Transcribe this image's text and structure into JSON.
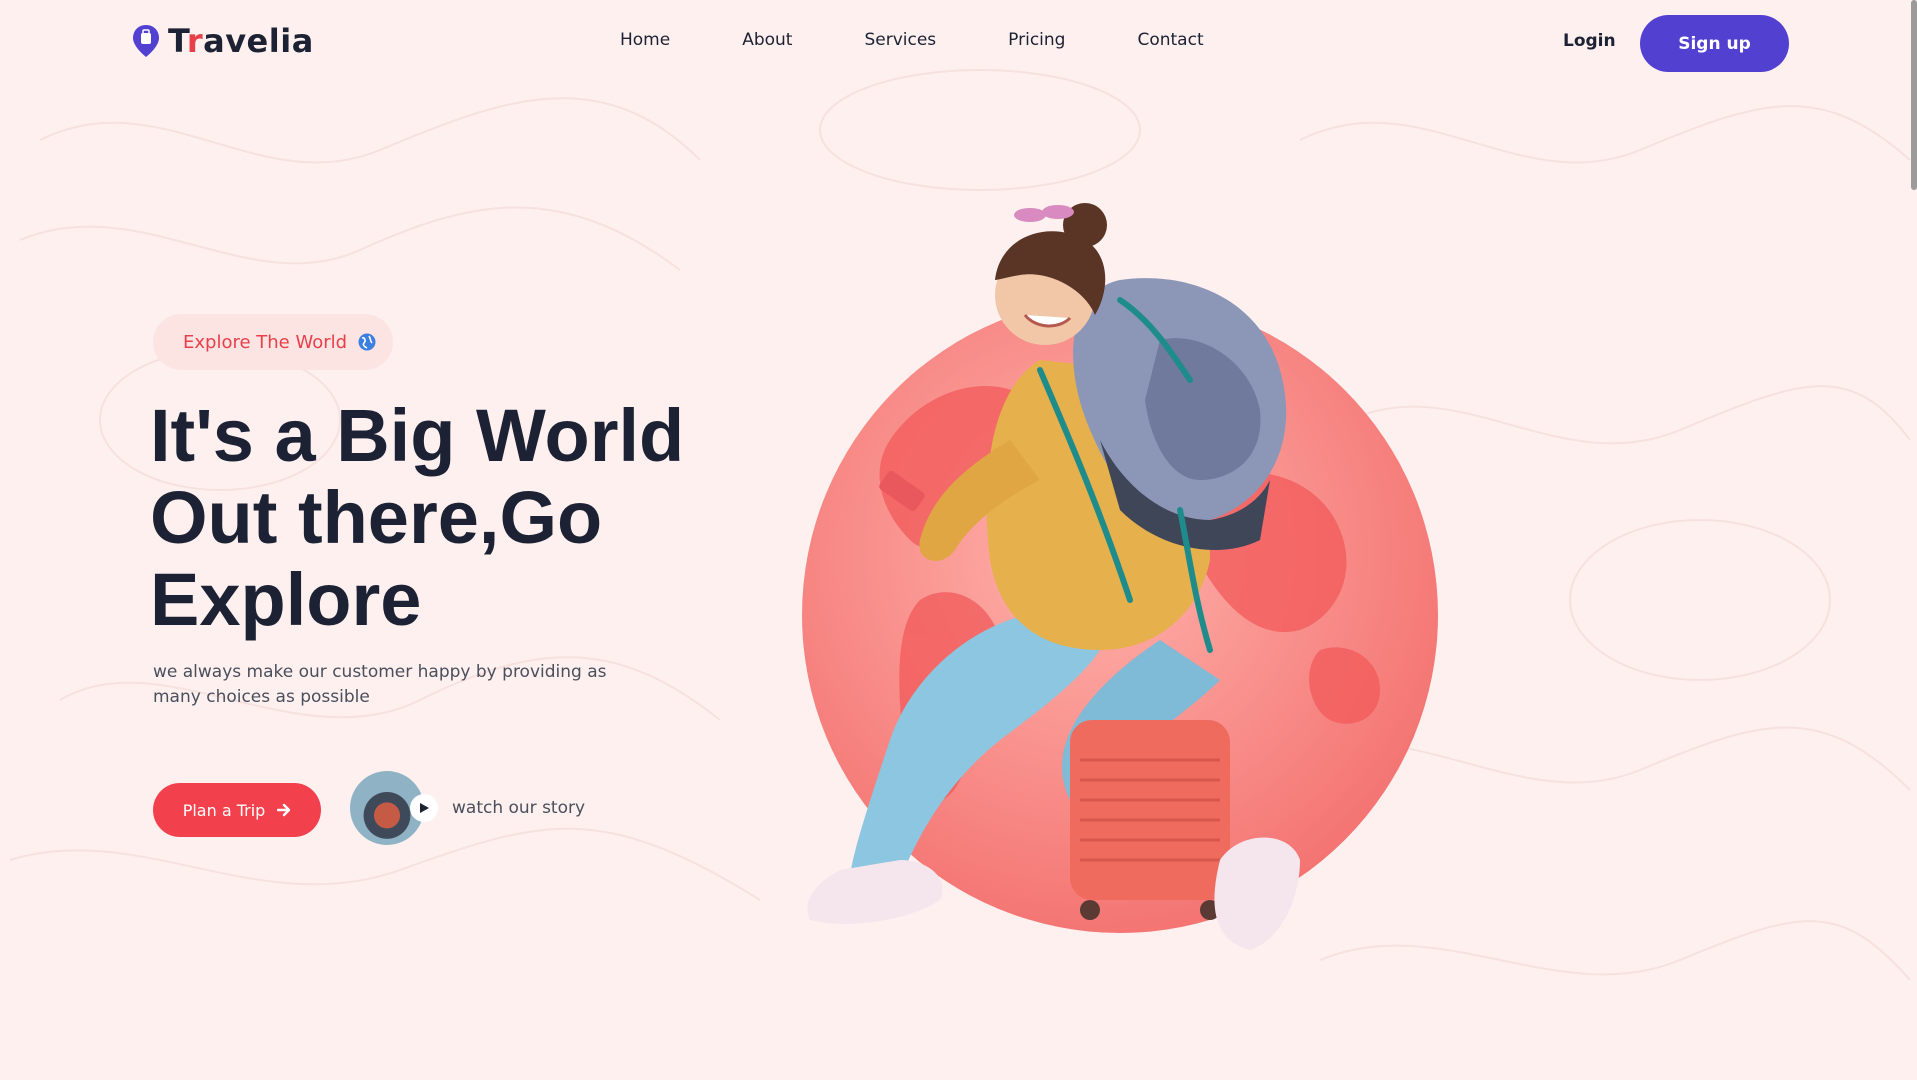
{
  "brand": {
    "name_first": "T",
    "name_accent": "r",
    "name_rest": "avelia",
    "logo_icon": "location-pin-icon",
    "accent_color": "#5240d1",
    "primary_color": "#f2404c"
  },
  "nav": {
    "items": [
      {
        "label": "Home"
      },
      {
        "label": "About"
      },
      {
        "label": "Services"
      },
      {
        "label": "Pricing"
      },
      {
        "label": "Contact"
      }
    ],
    "login_label": "Login",
    "signup_label": "Sign up"
  },
  "hero": {
    "tag": "Explore The World",
    "tag_icon": "globe-icon",
    "headline_lines": [
      "It's a Big World",
      "Out there,Go",
      "Explore"
    ],
    "subtext": "we always make our customer happy by providing as many choices as possible",
    "cta_label": "Plan a Trip",
    "cta_icon": "arrow-right-icon",
    "story_label": "watch our story",
    "story_icon": "play-icon"
  }
}
